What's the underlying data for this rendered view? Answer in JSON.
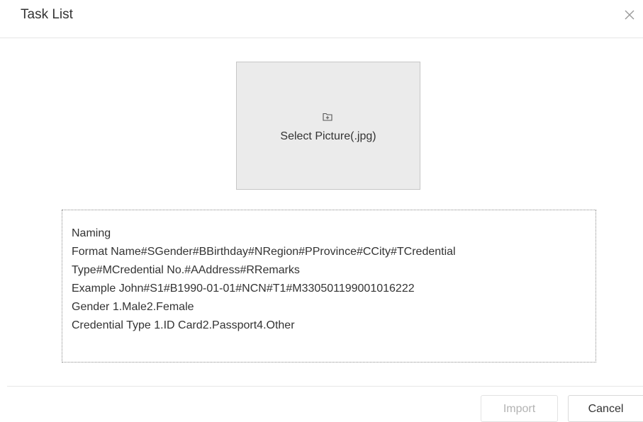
{
  "dialog": {
    "title": "Task List",
    "close_icon": "close-icon"
  },
  "upload": {
    "icon": "folder-icon",
    "label": "Select Picture(.jpg)"
  },
  "info": {
    "lines": [
      "Naming",
      "Format  Name#SGender#BBirthday#NRegion#PProvince#CCity#TCredential",
      "Type#MCredential No.#AAddress#RRemarks",
      "Example  John#S1#B1990-01-01#NCN#T1#M330501199001016222",
      "Gender  1.Male2.Female",
      "Credential Type  1.ID Card2.Passport4.Other"
    ]
  },
  "footer": {
    "import_label": "Import",
    "cancel_label": "Cancel"
  }
}
